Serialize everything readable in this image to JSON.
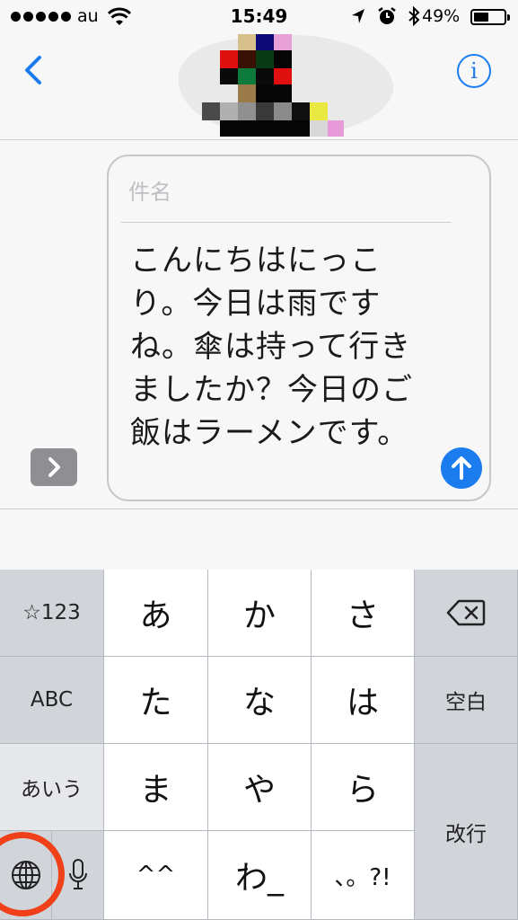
{
  "status_bar": {
    "carrier": "au",
    "time": "15:49",
    "battery_percent": "49%",
    "battery_level": 0.49,
    "icons": [
      "signal-dots-icon",
      "wifi-icon",
      "location-arrow-icon",
      "alarm-icon",
      "bluetooth-icon",
      "battery-icon"
    ]
  },
  "nav": {
    "back_icon": "chevron-left-icon",
    "info_label": "i",
    "accent_color": "#1b7cf0"
  },
  "composer": {
    "subject_placeholder": "件名",
    "body": "こんにちはにっこり。今日は雨ですね。傘は持って行きましたか？今日のご飯はラーメンです。",
    "send_icon": "arrow-up-icon",
    "expand_icon": "chevron-right-icon"
  },
  "keyboard": {
    "num_key": "☆123",
    "abc_key": "ABC",
    "kana_key": "あいう",
    "globe_icon": "globe-icon",
    "mic_icon": "microphone-icon",
    "delete_icon": "delete-backspace-icon",
    "space_key": "空白",
    "return_key": "改行",
    "kana_keys": [
      "あ",
      "か",
      "さ",
      "た",
      "な",
      "は",
      "ま",
      "や",
      "ら",
      "^^",
      "わ_",
      "、。?!"
    ],
    "highlight_color": "#f0401a"
  }
}
